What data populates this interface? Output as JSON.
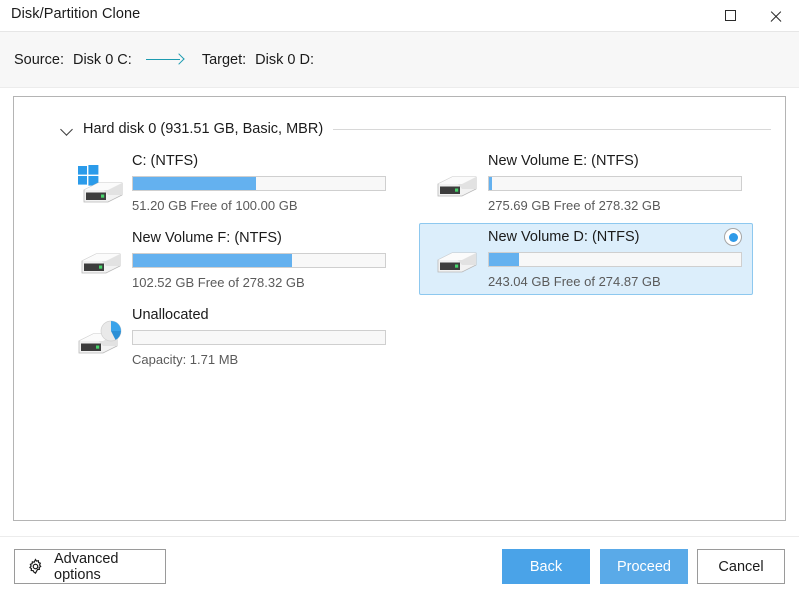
{
  "window": {
    "title": "Disk/Partition Clone",
    "controls": {
      "maximize": "maximize-icon",
      "close": "close-icon"
    }
  },
  "header": {
    "source_label": "Source:",
    "source_value": "Disk 0 C:",
    "arrow": "arrow-right-icon",
    "target_label": "Target:",
    "target_value": "Disk 0 D:"
  },
  "disk": {
    "expanded": true,
    "title": "Hard disk 0 (931.51 GB, Basic, MBR)",
    "chevron": "chevron-down-icon"
  },
  "partitions": [
    {
      "id": "c",
      "name": "C: (NTFS)",
      "meta": "51.20 GB Free of 100.00 GB",
      "used_percent": 49,
      "icon": "windows-drive-icon",
      "selected": false
    },
    {
      "id": "e",
      "name": "New Volume E: (NTFS)",
      "meta": "275.69 GB Free of 278.32 GB",
      "used_percent": 1,
      "icon": "drive-icon",
      "selected": false
    },
    {
      "id": "f",
      "name": "New Volume F: (NTFS)",
      "meta": "102.52 GB Free of 278.32 GB",
      "used_percent": 63,
      "icon": "drive-icon",
      "selected": false
    },
    {
      "id": "d",
      "name": "New Volume D: (NTFS)",
      "meta": "243.04 GB Free of 274.87 GB",
      "used_percent": 12,
      "icon": "drive-icon",
      "selected": true
    },
    {
      "id": "unallocated",
      "name": "Unallocated",
      "meta": "Capacity: 1.71 MB",
      "used_percent": 0,
      "icon": "unallocated-drive-icon",
      "selected": false
    }
  ],
  "footer": {
    "advanced_label": "Advanced options",
    "advanced_icon": "gear-icon",
    "back_label": "Back",
    "proceed_label": "Proceed",
    "cancel_label": "Cancel"
  },
  "colors": {
    "accent_blue": "#4aa3e8",
    "bar_fill": "#64b1ef",
    "selected_bg": "#dceefb",
    "selected_border": "#8dc8ef",
    "arrow_teal": "#1d9bb0"
  }
}
